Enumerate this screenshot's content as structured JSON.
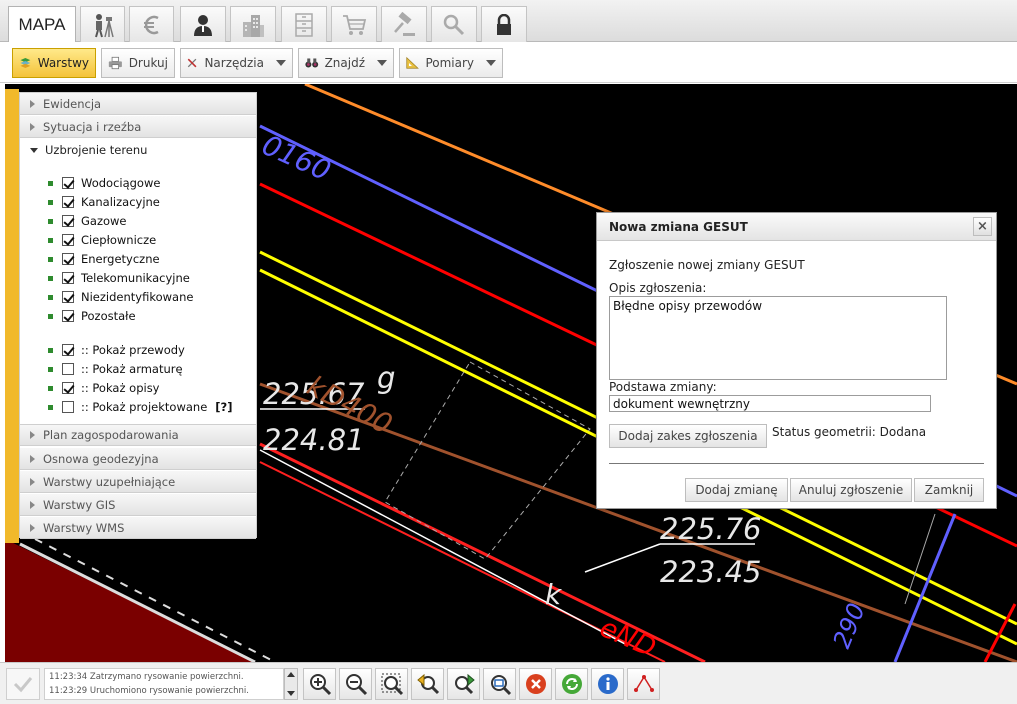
{
  "tabs": [
    {
      "label": "MAPA",
      "icon": "map-tab",
      "active": true
    },
    {
      "label": "",
      "icon": "surveyor-icon"
    },
    {
      "label": "",
      "icon": "euro-icon"
    },
    {
      "label": "",
      "icon": "user-icon"
    },
    {
      "label": "",
      "icon": "building-icon"
    },
    {
      "label": "",
      "icon": "cabinet-icon"
    },
    {
      "label": "",
      "icon": "cart-icon"
    },
    {
      "label": "",
      "icon": "gavel-icon"
    },
    {
      "label": "",
      "icon": "search-icon"
    },
    {
      "label": "",
      "icon": "lock-icon"
    }
  ],
  "toolbar": {
    "layers": "Warstwy",
    "print": "Drukuj",
    "tools": "Narzędzia",
    "find": "Znajdź",
    "measure": "Pomiary"
  },
  "layers_panel": {
    "sections_top": [
      "Ewidencja",
      "Sytuacja i rzeźba"
    ],
    "open_section": "Uzbrojenie terenu",
    "items": [
      {
        "label": "Wodociągowe",
        "checked": true
      },
      {
        "label": "Kanalizacyjne",
        "checked": true
      },
      {
        "label": "Gazowe",
        "checked": true
      },
      {
        "label": "Ciepłownicze",
        "checked": true
      },
      {
        "label": "Energetyczne",
        "checked": true
      },
      {
        "label": "Telekomunikacyjne",
        "checked": true
      },
      {
        "label": "Niezidentyfikowane",
        "checked": true
      },
      {
        "label": "Pozostałe",
        "checked": true
      }
    ],
    "options": [
      {
        "label": ":: Pokaż przewody",
        "checked": true
      },
      {
        "label": ":: Pokaż armaturę",
        "checked": false
      },
      {
        "label": ":: Pokaż opisy",
        "checked": true
      },
      {
        "label": ":: Pokaż projektowane",
        "checked": false,
        "help": "[?]"
      }
    ],
    "sections_bottom": [
      "Plan zagospodarowania",
      "Osnowa geodezyjna",
      "Warstwy uzupełniające",
      "Warstwy GIS",
      "Warstwy WMS"
    ]
  },
  "map_labels": {
    "n160": "0160",
    "elev1_top": "225.67",
    "elev1_bot": "224.81",
    "g": "g",
    "kd400": "kD400",
    "elev2_top": "225.76",
    "elev2_bot": "223.45",
    "k": "k",
    "end": "eND",
    "n290": "290"
  },
  "dialog": {
    "title": "Nowa zmiana GESUT",
    "close": "×",
    "subtitle": "Zgłoszenie nowej zmiany GESUT",
    "desc_label": "Opis zgłoszenia:",
    "desc_value": "Błędne opisy przewodów",
    "basis_label": "Podstawa zmiany:",
    "basis_value": "dokument wewnętrzny",
    "add_extent": "Dodaj zakes zgłoszenia",
    "geom_status": "Status geometrii: Dodana",
    "btn_add": "Dodaj zmianę",
    "btn_cancel": "Anuluj zgłoszenie",
    "btn_close": "Zamknij"
  },
  "status_log": [
    "11:23:34 Zatrzymano rysowanie powierzchni.",
    "11:23:29 Uruchomiono rysowanie powierzchni."
  ],
  "bottom_tools": [
    "zoom-in-icon",
    "zoom-out-icon",
    "zoom-extent-icon",
    "zoom-previous-icon",
    "zoom-next-icon",
    "zoom-window-icon",
    "cancel-icon",
    "refresh-icon",
    "info-icon",
    "vertex-edit-icon"
  ],
  "colors": {
    "accent": "#f1b92b",
    "map_bg": "#000000",
    "gas_line": "#ffff00",
    "red_line": "#ff0000",
    "orange_line": "#ff8c2a",
    "blue_line": "#6060ff",
    "brown_line": "#a0522d"
  }
}
